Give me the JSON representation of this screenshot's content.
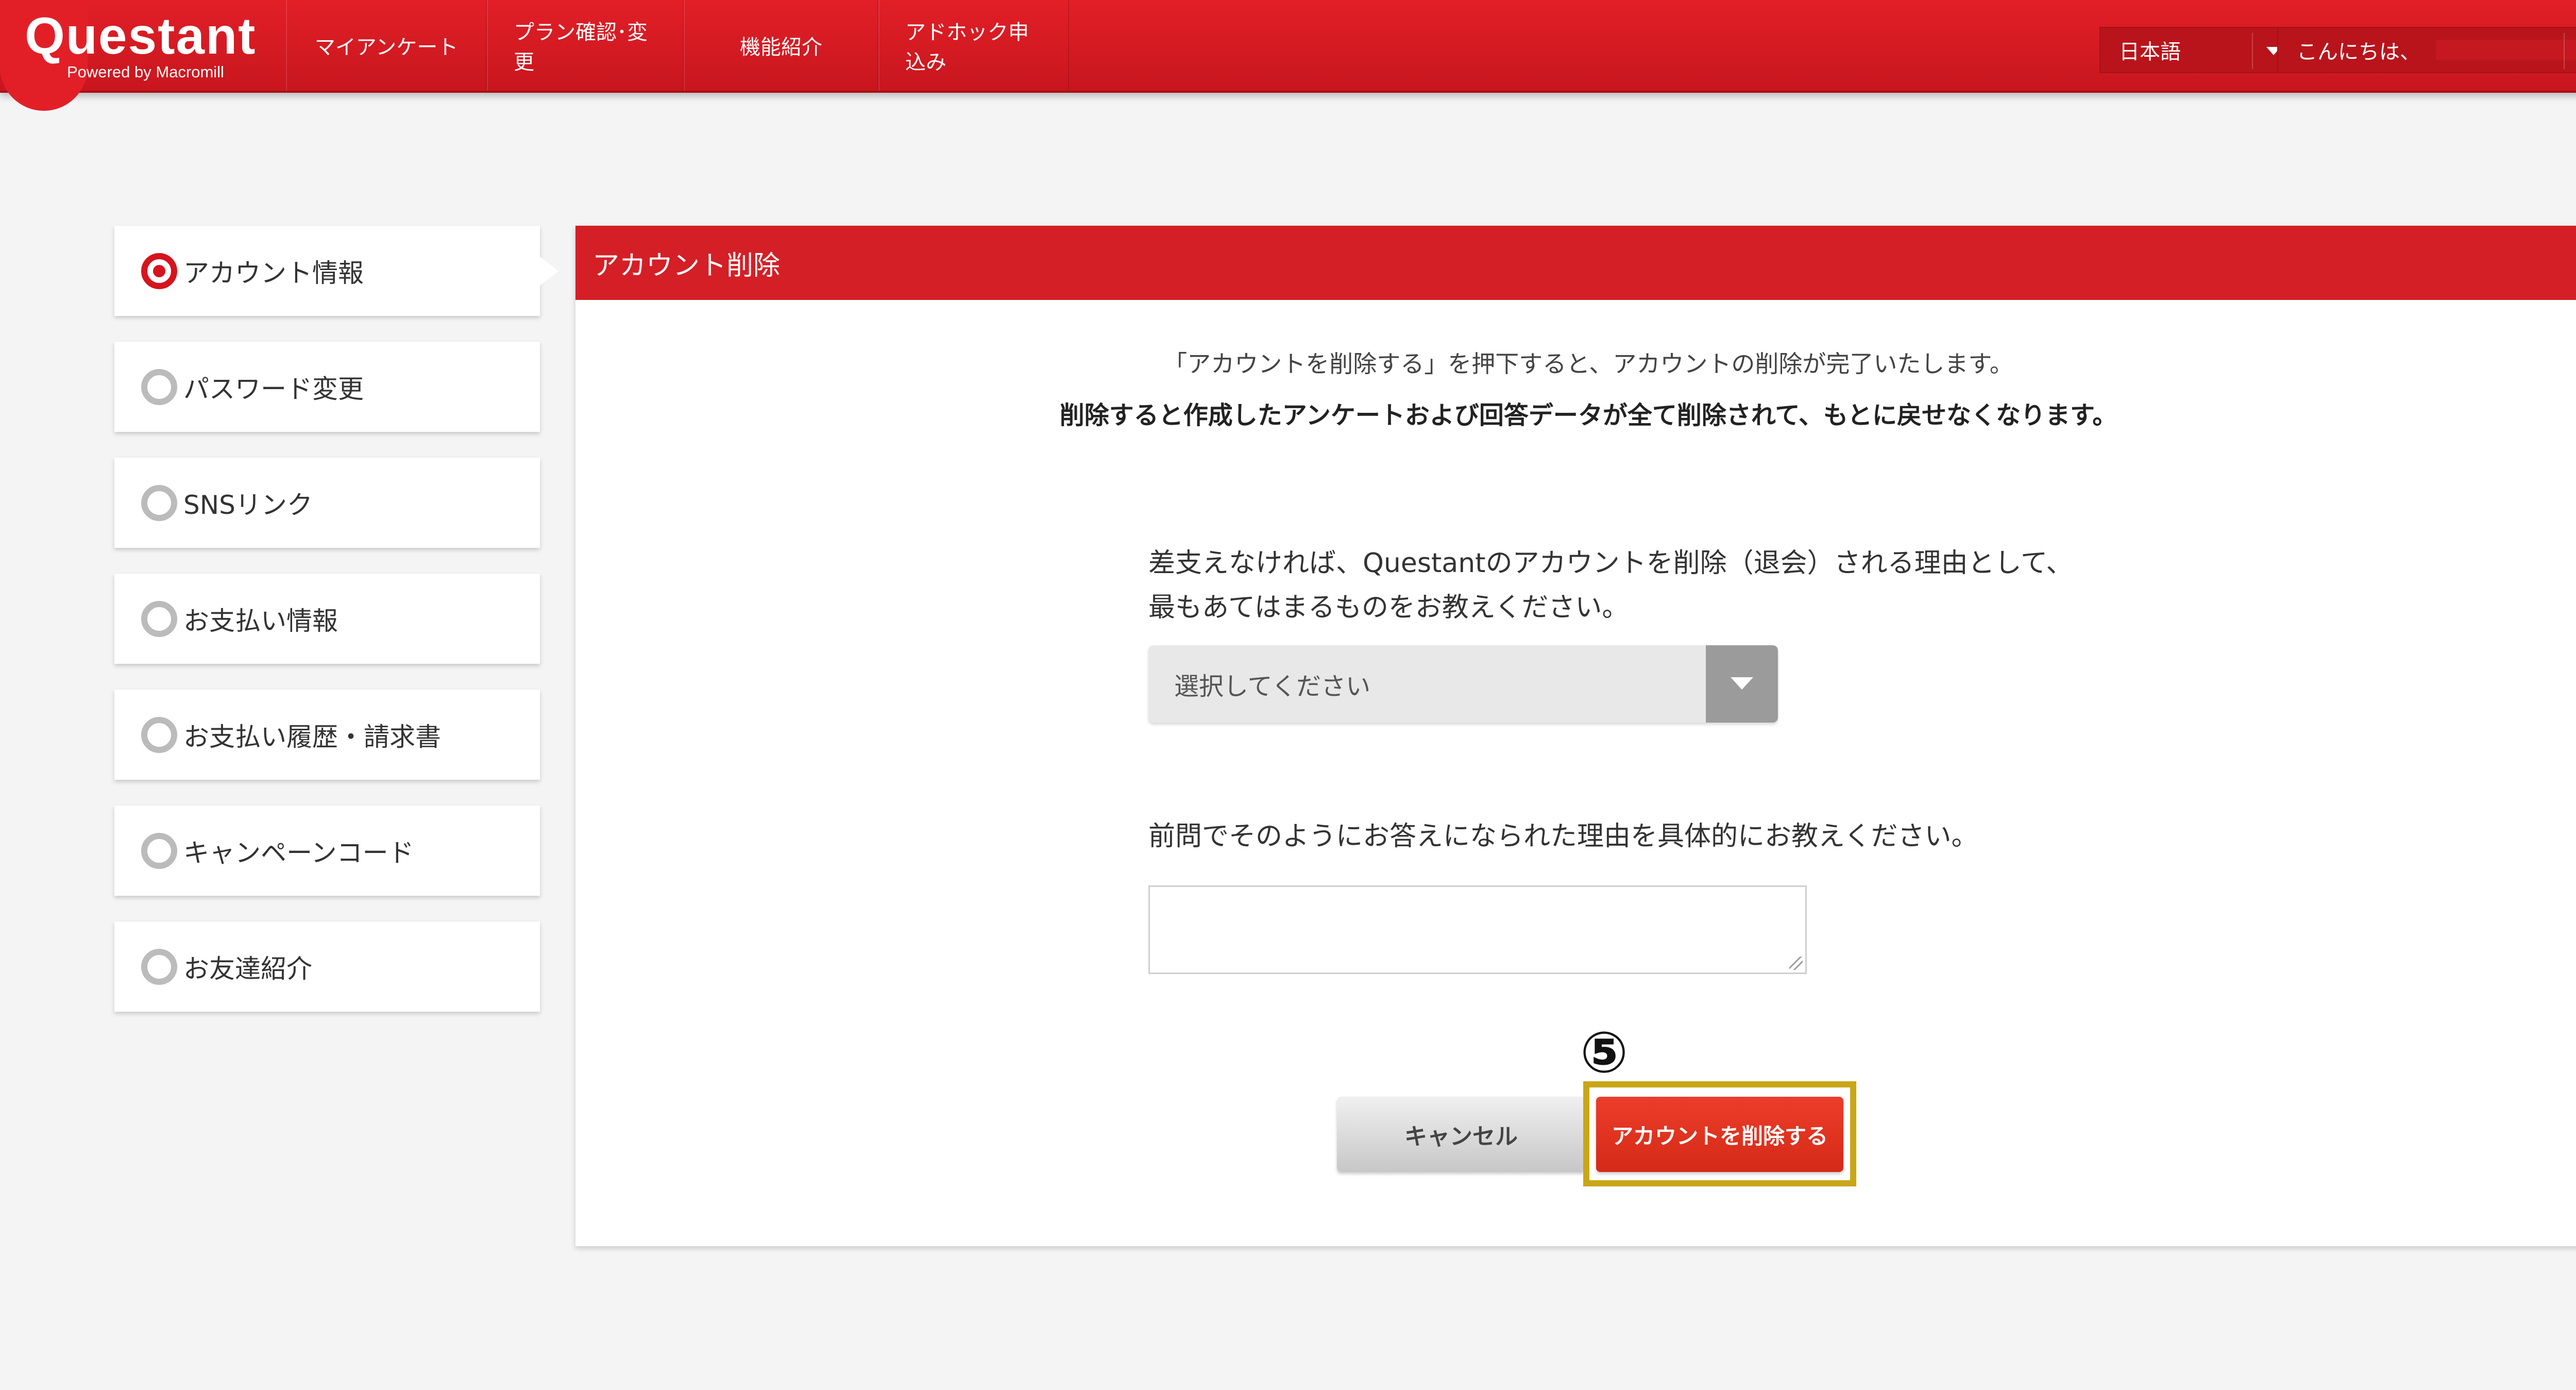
{
  "header": {
    "logo_text": "Questant",
    "logo_sub": "Powered by Macromill",
    "nav": [
      {
        "label": "マイアンケート"
      },
      {
        "label": "プラン確認･変更"
      },
      {
        "label": "機能紹介"
      },
      {
        "label": "アドホック申込み"
      }
    ],
    "language": "日本語",
    "greeting": "こんにちは、",
    "help_label": "?"
  },
  "sidebar": {
    "items": [
      {
        "label": "アカウント情報",
        "active": true
      },
      {
        "label": "パスワード変更",
        "active": false
      },
      {
        "label": "SNSリンク",
        "active": false
      },
      {
        "label": "お支払い情報",
        "active": false
      },
      {
        "label": "お支払い履歴・請求書",
        "active": false
      },
      {
        "label": "キャンペーンコード",
        "active": false
      },
      {
        "label": "お友達紹介",
        "active": false
      }
    ]
  },
  "panel": {
    "title": "アカウント削除",
    "notice": "「アカウントを削除する」を押下すると、アカウントの削除が完了いたします。",
    "notice_strong": "削除すると作成したアンケートおよび回答データが全て削除されて、もとに戻せなくなります。",
    "question1_line1": "差支えなければ、Questantのアカウントを削除（退会）される理由として、",
    "question1_line2": "最もあてはまるものをお教えください。",
    "select_value": "選択してください",
    "question2": "前問でそのようにお答えになられた理由を具体的にお教えください。",
    "textarea_value": "",
    "step_marker": "⑤",
    "cancel_label": "キャンセル",
    "delete_label": "アカウントを削除する"
  },
  "colors": {
    "brand_red": "#d41f26",
    "delete_button": "#e0321f",
    "highlight_border": "#c9a617"
  }
}
